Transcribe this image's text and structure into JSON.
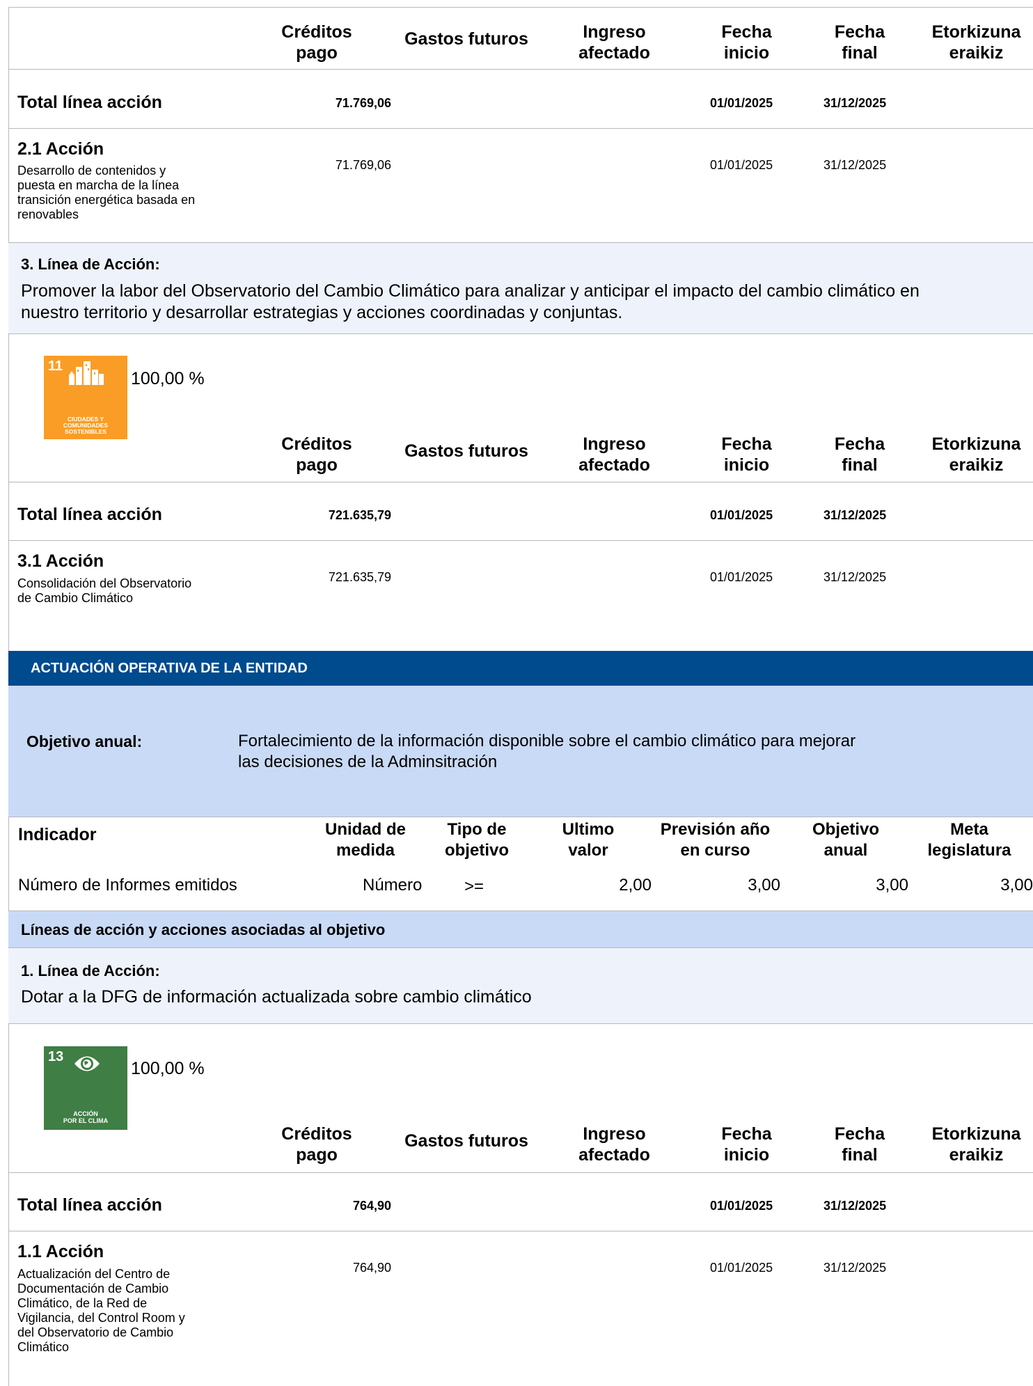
{
  "table_headers": {
    "creditos_pago": [
      "Créditos",
      "pago"
    ],
    "gastos_futuros": "Gastos futuros",
    "ingreso_afectado": [
      "Ingreso",
      "afectado"
    ],
    "fecha_inicio": [
      "Fecha",
      "inicio"
    ],
    "fecha_final": [
      "Fecha",
      "final"
    ],
    "etorkizuna": [
      "Etorkizuna",
      "eraikiz"
    ]
  },
  "total_linea_label": "Total línea acción",
  "block1": {
    "total": {
      "creditos": "71.769,06",
      "inicio": "01/01/2025",
      "final": "31/12/2025"
    },
    "accion": {
      "title": "2.1 Acción",
      "desc": [
        "Desarrollo de contenidos y",
        "puesta en marcha de la línea",
        "transición energética basada en",
        "renovables"
      ],
      "creditos": "71.769,06",
      "inicio": "01/01/2025",
      "final": "31/12/2025"
    }
  },
  "linea3": {
    "title": "3. Línea de Acción:",
    "text": [
      "Promover la labor del Observatorio del Cambio Climático para analizar y anticipar el impacto del cambio climático en",
      "nuestro territorio y desarrollar estrategias y acciones coordinadas y conjuntas."
    ]
  },
  "sdg11": {
    "number": "11",
    "caption": [
      "CIUDADES Y",
      "COMUNIDADES",
      "SOSTENIBLES"
    ],
    "color": "#f99d26",
    "percent": "100,00 %"
  },
  "block2": {
    "total": {
      "creditos": "721.635,79",
      "inicio": "01/01/2025",
      "final": "31/12/2025"
    },
    "accion": {
      "title": "3.1 Acción",
      "desc": [
        "Consolidación del Observatorio",
        "de Cambio Climático"
      ],
      "creditos": "721.635,79",
      "inicio": "01/01/2025",
      "final": "31/12/2025"
    }
  },
  "actuacion": {
    "title": "ACTUACIÓN OPERATIVA DE LA ENTIDAD",
    "color": "#004a8e",
    "objetivo_label": "Objetivo anual:",
    "objetivo_text": [
      "Fortalecimiento de la información disponible sobre el cambio climático para mejorar",
      "las decisiones de la Adminsitración"
    ]
  },
  "indicador_table": {
    "headers": {
      "indicador": "Indicador",
      "unidad": [
        "Unidad de",
        "medida"
      ],
      "tipo": [
        "Tipo de",
        "objetivo"
      ],
      "ultimo": [
        "Ultimo",
        "valor"
      ],
      "prevision": [
        "Previsión año",
        "en curso"
      ],
      "objetivo": [
        "Objetivo",
        "anual"
      ],
      "meta": [
        "Meta",
        "legislatura"
      ]
    },
    "row": {
      "indicador": "Número de Informes emitidos",
      "unidad": "Número",
      "tipo": ">=",
      "ultimo": "2,00",
      "prevision": "3,00",
      "objetivo": "3,00",
      "meta": "3,00"
    }
  },
  "lineas_header": "Líneas de acción y acciones asociadas al objetivo",
  "linea1": {
    "title": "1. Línea de Acción:",
    "text": "Dotar a la DFG de información actualizada sobre cambio climático"
  },
  "sdg13": {
    "number": "13",
    "caption": [
      "ACCIÓN",
      "POR EL CLIMA"
    ],
    "color": "#3f7e44",
    "percent": "100,00 %"
  },
  "block3": {
    "total": {
      "creditos": "764,90",
      "inicio": "01/01/2025",
      "final": "31/12/2025"
    },
    "accion": {
      "title": "1.1 Acción",
      "desc": [
        "Actualización del Centro de",
        "Documentación de Cambio",
        "Climático, de la Red de",
        "Vigilancia, del Control Room y",
        "del Observatorio de Cambio",
        "Climático"
      ],
      "creditos": "764,90",
      "inicio": "01/01/2025",
      "final": "31/12/2025"
    }
  }
}
